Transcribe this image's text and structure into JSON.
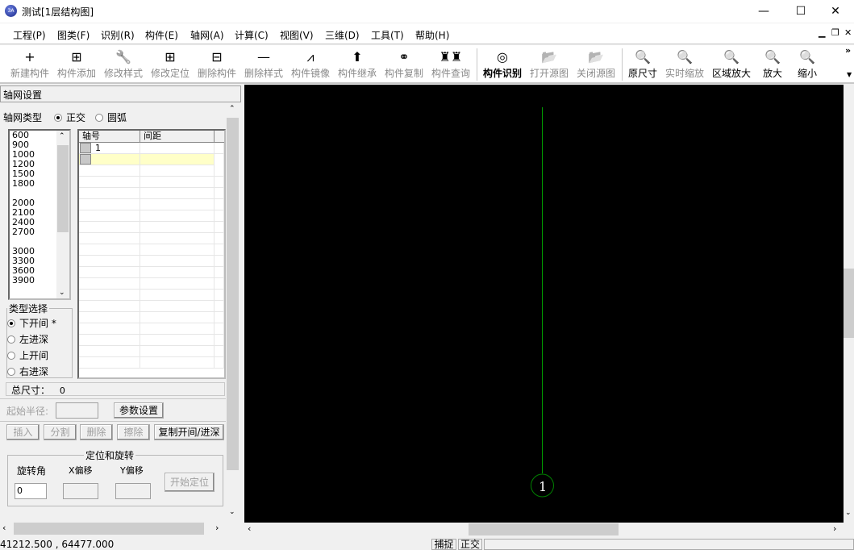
{
  "window": {
    "title": "测试[1层结构图]",
    "minimize": "—",
    "maximize": "☐",
    "close": "✕"
  },
  "menu": [
    "工程(P)",
    "图类(F)",
    "识别(R)",
    "构件(E)",
    "轴网(A)",
    "计算(C)",
    "视图(V)",
    "三维(D)",
    "工具(T)",
    "帮助(H)"
  ],
  "mdi": {
    "minimize": "▁",
    "restore": "❐",
    "close": "✕"
  },
  "toolbar": [
    {
      "label": "新建构件",
      "icon": "plus-icon",
      "glyph": "+",
      "enabled": false
    },
    {
      "label": "构件添加",
      "icon": "grid-add-icon",
      "glyph": "⊞",
      "enabled": false
    },
    {
      "label": "修改样式",
      "icon": "wrench-icon",
      "glyph": "🔧",
      "enabled": false
    },
    {
      "label": "修改定位",
      "icon": "grid-position-icon",
      "glyph": "⊞",
      "enabled": false
    },
    {
      "label": "删除构件",
      "icon": "grid-delete-icon",
      "glyph": "⊟",
      "enabled": false
    },
    {
      "label": "删除样式",
      "icon": "minus-icon",
      "glyph": "—",
      "enabled": false
    },
    {
      "label": "构件镜像",
      "icon": "mirror-icon",
      "glyph": "⩘",
      "enabled": false
    },
    {
      "label": "构件继承",
      "icon": "arrow-up-icon",
      "glyph": "⬆",
      "enabled": false
    },
    {
      "label": "构件复制",
      "icon": "copy-circles-icon",
      "glyph": "⚭",
      "enabled": false
    },
    {
      "label": "构件查询",
      "icon": "binoculars-icon",
      "glyph": "♜♜",
      "enabled": false
    },
    {
      "label": "构件识别",
      "icon": "disc-icon",
      "glyph": "◎",
      "enabled": true,
      "bold": true
    },
    {
      "label": "打开源图",
      "icon": "open-source-icon",
      "glyph": "📂",
      "enabled": false
    },
    {
      "label": "关闭源图",
      "icon": "close-source-icon",
      "glyph": "📂",
      "enabled": false
    },
    {
      "label": "原尺寸",
      "icon": "zoom-original-icon",
      "glyph": "🔍",
      "enabled": true
    },
    {
      "label": "实时缩放",
      "icon": "zoom-realtime-icon",
      "glyph": "🔍",
      "enabled": false
    },
    {
      "label": "区域放大",
      "icon": "zoom-window-icon",
      "glyph": "🔍",
      "enabled": true
    },
    {
      "label": "放大",
      "icon": "zoom-in-icon",
      "glyph": "🔍",
      "enabled": true
    },
    {
      "label": "缩小",
      "icon": "zoom-out-icon",
      "glyph": "🔍",
      "enabled": true
    }
  ],
  "toolbar_more": "»",
  "panel": {
    "title": "轴网设置",
    "grid_type_label": "轴网类型",
    "grid_types": [
      {
        "label": "正交",
        "selected": true
      },
      {
        "label": "圆弧",
        "selected": false
      }
    ],
    "sizes": [
      "600",
      "900",
      "1000",
      "1200",
      "1500",
      "1800",
      "",
      "2000",
      "2100",
      "2400",
      "2700",
      "",
      "3000",
      "3300",
      "3600",
      "3900"
    ],
    "table": {
      "headers": [
        "轴号",
        "间距"
      ],
      "rows": [
        [
          "1",
          ""
        ],
        [
          "",
          ""
        ]
      ]
    },
    "type_select": {
      "legend": "类型选择",
      "options": [
        {
          "label": "下开间 *",
          "selected": true
        },
        {
          "label": "左进深",
          "selected": false
        },
        {
          "label": "上开间",
          "selected": false
        },
        {
          "label": "右进深",
          "selected": false
        }
      ]
    },
    "total_label": "总尺寸：",
    "total_value": "0",
    "start_radius_label": "起始半径:",
    "start_radius_value": "",
    "param_button": "参数设置",
    "buttons": [
      {
        "label": "插入",
        "enabled": false
      },
      {
        "label": "分割",
        "enabled": false
      },
      {
        "label": "删除",
        "enabled": false
      },
      {
        "label": "擦除",
        "enabled": false
      },
      {
        "label": "复制开间/进深",
        "enabled": true
      }
    ],
    "position": {
      "legend": "定位和旋转",
      "rotation_label": "旋转角",
      "rotation_value": "0",
      "x_label": "X偏移",
      "x_value": "",
      "y_label": "Y偏移",
      "y_value": "",
      "start_button": "开始定位"
    }
  },
  "canvas": {
    "axis_label": "1",
    "line_color": "#00a000",
    "circle_color": "#008000"
  },
  "status": {
    "coords": "41212.500 , 64477.000",
    "snap": "捕捉",
    "ortho": "正交"
  }
}
